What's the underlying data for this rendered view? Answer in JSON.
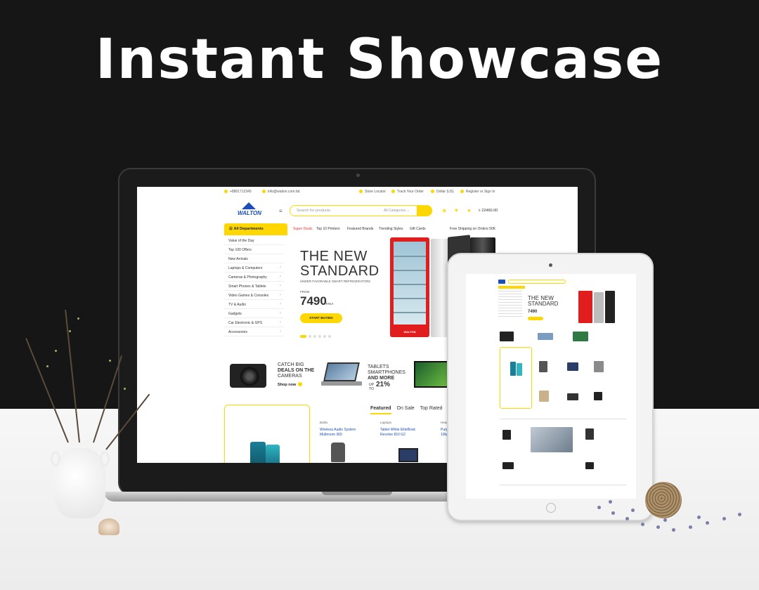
{
  "headline": "Instant Showcase",
  "site": {
    "topbar": {
      "phone": "+8801712345",
      "email": "info@walton.com.bd",
      "store_locator": "Store Locator",
      "track_order": "Track Your Order",
      "currency": "Dollar (US)",
      "account": "Register or Sign In"
    },
    "logo_text": "WALTON",
    "search": {
      "placeholder": "Search for products",
      "category": "All Categories"
    },
    "cart_total": "৳ 22460.00",
    "departments_label": "All Departments",
    "departments": [
      {
        "label": "Value of the Day",
        "has_children": false
      },
      {
        "label": "Top 100 Offers",
        "has_children": false
      },
      {
        "label": "New Arrivals",
        "has_children": false
      },
      {
        "label": "Laptops & Computers",
        "has_children": true
      },
      {
        "label": "Cameras & Photography",
        "has_children": true
      },
      {
        "label": "Smart Phones & Tablets",
        "has_children": true
      },
      {
        "label": "Video Games & Consoles",
        "has_children": true
      },
      {
        "label": "TV & Audio",
        "has_children": true
      },
      {
        "label": "Gadgets",
        "has_children": true
      },
      {
        "label": "Car Electronic & GPS",
        "has_children": true
      },
      {
        "label": "Accessories",
        "has_children": true
      }
    ],
    "nav": {
      "super_deals": "Super Deals",
      "top_printers": "Top 10 Printers",
      "featured_brands": "Featured Brands",
      "trending_styles": "Trending Styles",
      "gift_cards": "Gift Cards",
      "free_shipping": "Free Shipping on Orders 50K"
    },
    "hero": {
      "title_line1": "THE NEW",
      "title_line2": "STANDARD",
      "subtitle": "UNDER FAVORABLE SMART REFRIGERATORS",
      "from_label": "FROM",
      "price": "7490",
      "currency": "TAKA",
      "cta": "START BUYING",
      "fridge_label": "WALTON"
    },
    "promos": {
      "camera_line1": "CATCH BIG",
      "camera_line2": "DEALS ON THE",
      "camera_line3": "CAMERAS",
      "camera_link": "Shop now",
      "tablet_line1": "TABLETS",
      "tablet_line2": "SMARTPHONES",
      "tablet_line3": "AND MORE",
      "discount_up": "UP",
      "discount_to": "TO",
      "discount_pct": "21%"
    },
    "product_tabs": [
      "Featured",
      "On Sale",
      "Top Rated"
    ],
    "products": [
      {
        "category": "Bulbs",
        "name_line1": "Wireless Audio System",
        "name_line2": "Multiroom 360"
      },
      {
        "category": "Laptops",
        "name_line1": "Tablet White EliteBook",
        "name_line2": "Revolve 810 G2"
      },
      {
        "category": "Headphones",
        "name_line1": "Purple Solo 2",
        "name_line2": "10kg"
      }
    ]
  },
  "tablet_site": {
    "title_line1": "THE NEW",
    "title_line2": "STANDARD",
    "price": "7490"
  },
  "colors": {
    "accent": "#fed700",
    "brand_blue": "#1c4fb7",
    "hot": "#e53935"
  }
}
